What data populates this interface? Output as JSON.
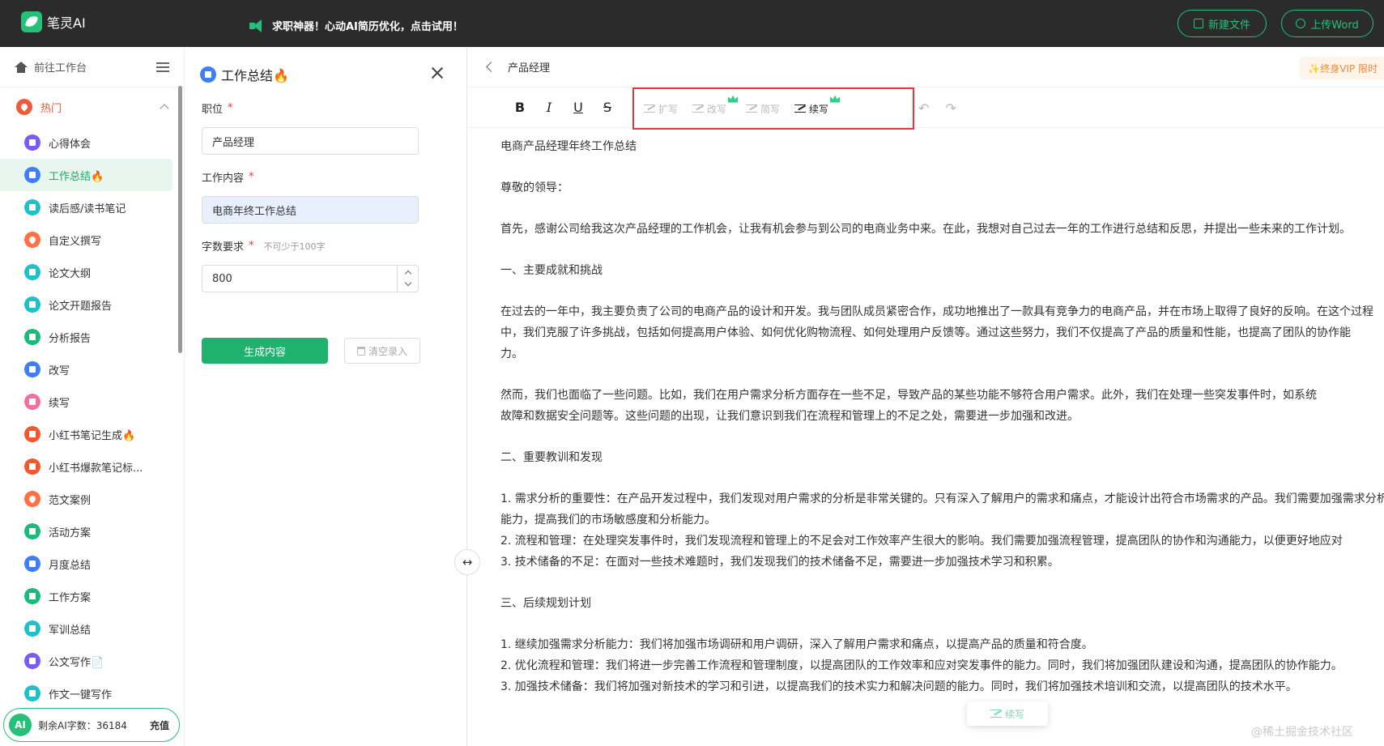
{
  "app": {
    "name": "笔灵AI",
    "promo": "求职神器！心动AI简历优化，点击试用！",
    "new_file": "新建文件",
    "upload_word": "上传Word"
  },
  "sidebar": {
    "go_workspace": "前往工作台",
    "section_hot": "热门",
    "items": [
      {
        "label": "心得体会",
        "icon": "purple"
      },
      {
        "label": "工作总结🔥",
        "icon": "blue"
      },
      {
        "label": "读后感/读书笔记",
        "icon": "teal"
      },
      {
        "label": "自定义撰写",
        "icon": "fire"
      },
      {
        "label": "论文大纲",
        "icon": "teal"
      },
      {
        "label": "论文开题报告",
        "icon": "teal"
      },
      {
        "label": "分析报告",
        "icon": "green"
      },
      {
        "label": "改写",
        "icon": "blue"
      },
      {
        "label": "续写",
        "icon": "pink"
      },
      {
        "label": "小红书笔记生成🔥",
        "icon": "orange"
      },
      {
        "label": "小红书爆款笔记标...",
        "icon": "orange"
      },
      {
        "label": "范文案例",
        "icon": "fire"
      },
      {
        "label": "活动方案",
        "icon": "green"
      },
      {
        "label": "月度总结",
        "icon": "blue"
      },
      {
        "label": "工作方案",
        "icon": "green"
      },
      {
        "label": "军训总结",
        "icon": "teal"
      },
      {
        "label": "公文写作📄",
        "icon": "purple"
      },
      {
        "label": "作文一键写作",
        "icon": "teal"
      }
    ],
    "footer_badge": "AI",
    "remaining_label": "剩余AI字数：36184",
    "charge": "充值"
  },
  "form": {
    "title": "工作总结🔥",
    "position_label": "职位",
    "position_value": "产品经理",
    "content_label": "工作内容",
    "content_value": "电商年终工作总结",
    "words_label": "字数要求",
    "words_hint": "不可少于100字",
    "words_value": "800",
    "generate": "生成内容",
    "clear": "清空录入"
  },
  "editor": {
    "breadcrumb": "产品经理",
    "vip": "✨终身VIP 限时",
    "ai_tools": {
      "expand": "扩写",
      "rewrite": "改写",
      "shorten": "简写",
      "continue": "续写"
    },
    "floating_continue": "续写",
    "watermark": "@稀土掘金技术社区",
    "paragraphs": [
      {
        "text": "电商产品经理年终工作总结",
        "gap": true
      },
      {
        "text": "尊敬的领导：",
        "gap": true
      },
      {
        "text": "首先，感谢公司给我这次产品经理的工作机会，让我有机会参与到公司的电商业务中来。在此，我想对自己过去一年的工作进行总结和反思，并提出一些未来的工作计划。",
        "gap": true
      },
      {
        "text": "一、主要成就和挑战",
        "gap": true
      },
      {
        "text": "在过去的一年中，我主要负责了公司的电商产品的设计和开发。我与团队成员紧密合作，成功地推出了一款具有竞争力的电商产品，并在市场上取得了良好的反响。在这个过程",
        "gap": false
      },
      {
        "text": "中，我们克服了许多挑战，包括如何提高用户体验、如何优化购物流程、如何处理用户反馈等。通过这些努力，我们不仅提高了产品的质量和性能，也提高了团队的协作能",
        "gap": false
      },
      {
        "text": "力。",
        "gap": true
      },
      {
        "text": "然而，我们也面临了一些问题。比如，我们在用户需求分析方面存在一些不足，导致产品的某些功能不够符合用户需求。此外，我们在处理一些突发事件时，如系统",
        "gap": false
      },
      {
        "text": "故障和数据安全问题等。这些问题的出现，让我们意识到我们在流程和管理上的不足之处，需要进一步加强和改进。",
        "gap": true
      },
      {
        "text": "二、重要教训和发现",
        "gap": true
      },
      {
        "text": "1. 需求分析的重要性：在产品开发过程中，我们发现对用户需求的分析是非常关键的。只有深入了解用户的需求和痛点，才能设计出符合市场需求的产品。我们需要加强需求分析",
        "gap": false
      },
      {
        "text": "能力，提高我们的市场敏感度和分析能力。",
        "gap": false
      },
      {
        "text": "2. 流程和管理：在处理突发事件时，我们发现流程和管理上的不足会对工作效率产生很大的影响。我们需要加强流程管理，提高团队的协作和沟通能力，以便更好地应对",
        "gap": false
      },
      {
        "text": "3. 技术储备的不足：在面对一些技术难题时，我们发现我们的技术储备不足，需要进一步加强技术学习和积累。",
        "gap": true
      },
      {
        "text": "三、后续规划计划",
        "gap": true
      },
      {
        "text": "1. 继续加强需求分析能力：我们将加强市场调研和用户调研，深入了解用户需求和痛点，以提高产品的质量和符合度。",
        "gap": false
      },
      {
        "text": "2. 优化流程和管理：我们将进一步完善工作流程和管理制度，以提高团队的工作效率和应对突发事件的能力。同时，我们将加强团队建设和沟通，提高团队的协作能力。",
        "gap": false
      },
      {
        "text": "3. 加强技术储备：我们将加强对新技术的学习和引进，以提高我们的技术实力和解决问题的能力。同时，我们将加强技术培训和交流，以提高团队的技术水平。",
        "gap": false
      }
    ]
  },
  "colors": {
    "brand": "#25c07a",
    "highlight_box": "#e23a3a",
    "topbar": "#2b2b2b"
  }
}
